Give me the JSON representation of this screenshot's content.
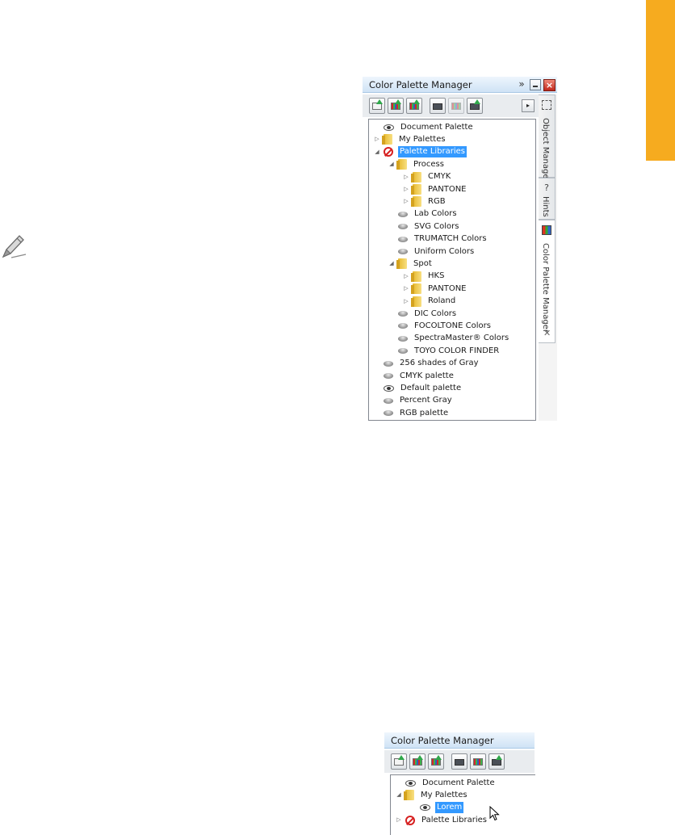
{
  "panel1": {
    "title": "Color Palette Manager",
    "expand_glyph": "»",
    "close_glyph": "×",
    "flyout_glyph": "▸",
    "tree": [
      {
        "label": "Document Palette",
        "icon": "eye",
        "expander": "",
        "level": 0,
        "selected": false
      },
      {
        "label": "My Palettes",
        "icon": "folder",
        "expander": "▷",
        "level": 0,
        "selected": false
      },
      {
        "label": "Palette Libraries",
        "icon": "nope",
        "expander": "◢",
        "level": 0,
        "selected": true
      },
      {
        "label": "Process",
        "icon": "folder",
        "expander": "◢",
        "level": 1,
        "selected": false
      },
      {
        "label": "CMYK",
        "icon": "folder",
        "expander": "▷",
        "level": 2,
        "selected": false
      },
      {
        "label": "PANTONE",
        "icon": "folder",
        "expander": "▷",
        "level": 2,
        "selected": false
      },
      {
        "label": "RGB",
        "icon": "folder",
        "expander": "▷",
        "level": 2,
        "selected": false
      },
      {
        "label": "Lab Colors",
        "icon": "pal",
        "expander": "",
        "level": 1,
        "selected": false
      },
      {
        "label": "SVG Colors",
        "icon": "pal",
        "expander": "",
        "level": 1,
        "selected": false
      },
      {
        "label": "TRUMATCH Colors",
        "icon": "pal",
        "expander": "",
        "level": 1,
        "selected": false
      },
      {
        "label": "Uniform Colors",
        "icon": "pal",
        "expander": "",
        "level": 1,
        "selected": false
      },
      {
        "label": "Spot",
        "icon": "folder",
        "expander": "◢",
        "level": 1,
        "selected": false
      },
      {
        "label": "HKS",
        "icon": "folder",
        "expander": "▷",
        "level": 2,
        "selected": false
      },
      {
        "label": "PANTONE",
        "icon": "folder",
        "expander": "▷",
        "level": 2,
        "selected": false
      },
      {
        "label": "Roland",
        "icon": "folder",
        "expander": "▷",
        "level": 2,
        "selected": false
      },
      {
        "label": "DIC Colors",
        "icon": "pal",
        "expander": "",
        "level": 1,
        "selected": false
      },
      {
        "label": "FOCOLTONE Colors",
        "icon": "pal",
        "expander": "",
        "level": 1,
        "selected": false
      },
      {
        "label": "SpectraMaster® Colors",
        "icon": "pal",
        "expander": "",
        "level": 1,
        "selected": false
      },
      {
        "label": "TOYO COLOR FINDER",
        "icon": "pal",
        "expander": "",
        "level": 1,
        "selected": false
      },
      {
        "label": "256 shades of Gray",
        "icon": "pal",
        "expander": "",
        "level": 0,
        "selected": false
      },
      {
        "label": "CMYK palette",
        "icon": "pal",
        "expander": "",
        "level": 0,
        "selected": false
      },
      {
        "label": "Default palette",
        "icon": "eye",
        "expander": "",
        "level": 0,
        "selected": false
      },
      {
        "label": "Percent Gray",
        "icon": "pal",
        "expander": "",
        "level": 0,
        "selected": false
      },
      {
        "label": "RGB palette",
        "icon": "pal",
        "expander": "",
        "level": 0,
        "selected": false
      }
    ],
    "side_tabs": {
      "object_manager": "Object Manager",
      "hints": "Hints",
      "color_palette_manager": "Color Palette Manager"
    }
  },
  "panel2": {
    "title": "Color Palette Manager",
    "tree": [
      {
        "label": "Document Palette",
        "icon": "eye",
        "expander": "",
        "level": 0,
        "selected": false
      },
      {
        "label": "My Palettes",
        "icon": "folder",
        "expander": "◢",
        "level": 0,
        "selected": false
      },
      {
        "label": "Lorem",
        "icon": "eye",
        "expander": "",
        "level": 1,
        "selected": true
      },
      {
        "label": "Palette Libraries",
        "icon": "nope",
        "expander": "▷",
        "level": 0,
        "selected": false
      }
    ]
  },
  "colors": {
    "accent_orange": "#f6ab1f",
    "selection": "#3399ff",
    "titlebar": "#cfe3f5"
  }
}
